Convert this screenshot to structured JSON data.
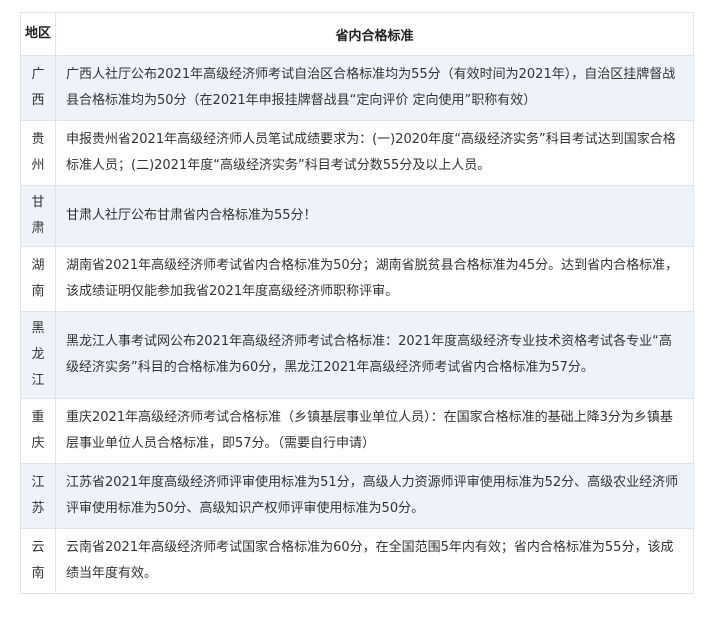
{
  "table": {
    "header": {
      "region": "地区",
      "standard": "省内合格标准"
    },
    "rows": [
      {
        "region": "广西",
        "text": "广西人社厅公布2021年高级经济师考试自治区合格标准均为55分（有效时间为2021年），自治区挂牌督战县合格标准均为50分（在2021年申报挂牌督战县“定向评价 定向使用”职称有效）"
      },
      {
        "region": "贵州",
        "text": "申报贵州省2021年高级经济师人员笔试成绩要求为：(一)2020年度“高级经济实务”科目考试达到国家合格标准人员；(二)2021年度“高级经济实务”科目考试分数55分及以上人员。"
      },
      {
        "region": "甘肃",
        "text": "甘肃人社厅公布甘肃省内合格标准为55分！"
      },
      {
        "region": "湖南",
        "text": "湖南省2021年高级经济师考试省内合格标准为50分；湖南省脱贫县合格标准为45分。达到省内合格标准，该成绩证明仅能参加我省2021年度高级经济师职称评审。"
      },
      {
        "region": "黑龙江",
        "text": "黑龙江人事考试网公布2021年高级经济师考试合格标准：2021年度高级经济专业技术资格考试各专业“高级经济实务”科目的合格标准为60分，黑龙江2021年高级经济师考试省内合格标准为57分。"
      },
      {
        "region": "重庆",
        "text": "重庆2021年高级经济师考试合格标准（乡镇基层事业单位人员）：在国家合格标准的基础上降3分为乡镇基层事业单位人员合格标准，即57分。（需要自行申请）"
      },
      {
        "region": "江苏",
        "text": "江苏省2021年度高级经济师评审使用标准为51分，高级人力资源师评审使用标准为52分、高级农业经济师评审使用标准为50分、高级知识产权师评审使用标准为50分。"
      },
      {
        "region": "云南",
        "text": "云南省2021年高级经济师考试国家合格标准为60分，在全国范围5年内有效；省内合格标准为55分，该成绩当年度有效。"
      }
    ]
  }
}
